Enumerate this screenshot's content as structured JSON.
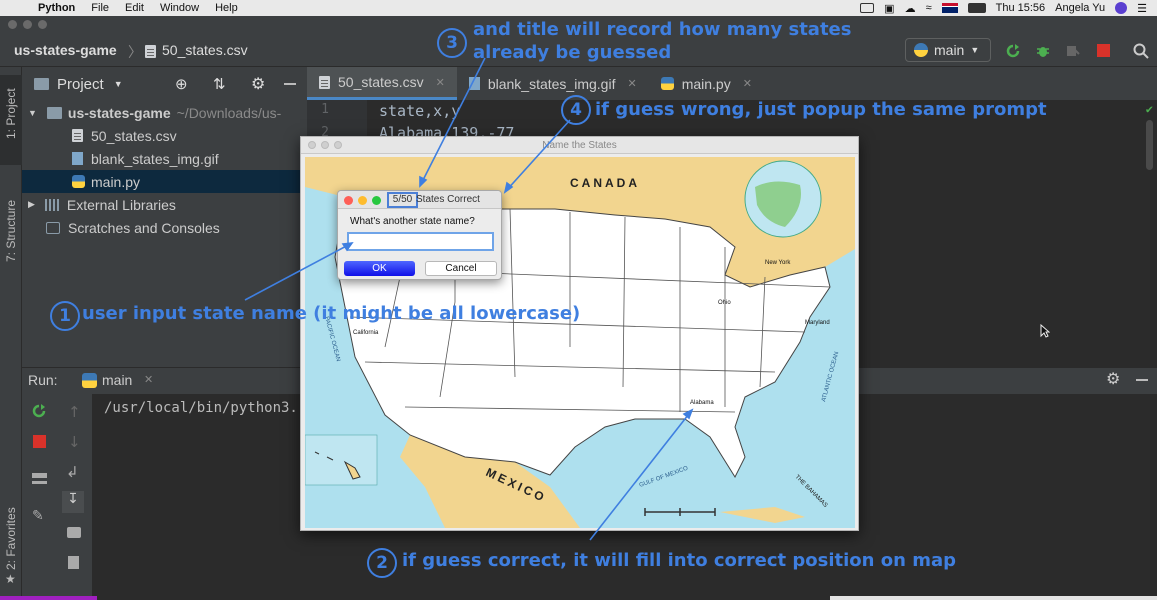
{
  "menubar": {
    "app": "Python",
    "items": [
      "File",
      "Edit",
      "Window",
      "Help"
    ],
    "clock": "Thu 15:56",
    "user": "Angela Yu"
  },
  "navbar": {
    "project": "us-states-game",
    "file": "50_states.csv",
    "branch": "main"
  },
  "sidebar": {
    "project_tab": "1: Project",
    "structure_tab": "7: Structure",
    "favorites_tab": "2: Favorites"
  },
  "project_panel": {
    "title": "Project",
    "root_name": "us-states-game",
    "root_path": "~/Downloads/us-",
    "files": [
      "50_states.csv",
      "blank_states_img.gif",
      "main.py"
    ],
    "external": "External Libraries",
    "scratches": "Scratches and Consoles"
  },
  "editor": {
    "tabs": [
      "50_states.csv",
      "blank_states_img.gif",
      "main.py"
    ],
    "line_numbers": [
      "1",
      "2"
    ],
    "lines": [
      "state,x,y",
      "Alabama,139,-77"
    ]
  },
  "run": {
    "label": "Run:",
    "config": "main",
    "output": "/usr/local/bin/python3."
  },
  "turtle": {
    "title": "Name the States",
    "map_labels": {
      "canada": "CANADA",
      "mexico": "MEXICO",
      "gulf": "GULF OF MEXICO",
      "atlantic": "ATLANTIC OCEAN",
      "pacific": "PACIFIC OCEAN",
      "bahamas": "THE BAHAMAS",
      "new_york": "New York",
      "ohio": "Ohio",
      "maryland": "Maryland",
      "california": "California",
      "alabama": "Alabama"
    }
  },
  "dialog": {
    "count": "5/50",
    "title_suffix": "States Correct",
    "prompt": "What's another state name?",
    "input_value": "",
    "ok": "OK",
    "cancel": "Cancel"
  },
  "annotations": {
    "a1_num": "1",
    "a1_text": "user input state name (it might be all lowercase)",
    "a2_num": "2",
    "a2_text": "if guess correct, it will fill into correct position on map",
    "a3_num": "3",
    "a3_line1": "and title will record how many states",
    "a3_line2": "already be guessed",
    "a4_num": "4",
    "a4_text": "if guess wrong, just popup the same prompt"
  },
  "colors": {
    "annotation": "#3f7fe0",
    "ide_bg": "#2b2b2b",
    "panel_bg": "#3c3f41",
    "map_ocean": "#aee0ee",
    "map_land": "#f2d58f"
  }
}
